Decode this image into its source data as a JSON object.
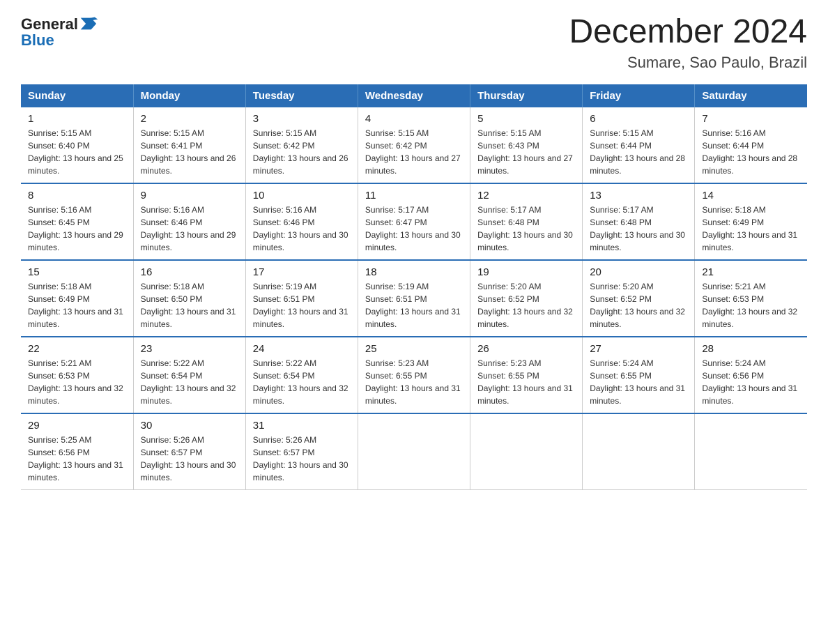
{
  "logo": {
    "text_general": "General",
    "text_blue": "Blue",
    "arrow_color": "#1a6db5"
  },
  "title": "December 2024",
  "subtitle": "Sumare, Sao Paulo, Brazil",
  "headers": [
    "Sunday",
    "Monday",
    "Tuesday",
    "Wednesday",
    "Thursday",
    "Friday",
    "Saturday"
  ],
  "weeks": [
    [
      {
        "day": "1",
        "sunrise": "5:15 AM",
        "sunset": "6:40 PM",
        "daylight": "13 hours and 25 minutes."
      },
      {
        "day": "2",
        "sunrise": "5:15 AM",
        "sunset": "6:41 PM",
        "daylight": "13 hours and 26 minutes."
      },
      {
        "day": "3",
        "sunrise": "5:15 AM",
        "sunset": "6:42 PM",
        "daylight": "13 hours and 26 minutes."
      },
      {
        "day": "4",
        "sunrise": "5:15 AM",
        "sunset": "6:42 PM",
        "daylight": "13 hours and 27 minutes."
      },
      {
        "day": "5",
        "sunrise": "5:15 AM",
        "sunset": "6:43 PM",
        "daylight": "13 hours and 27 minutes."
      },
      {
        "day": "6",
        "sunrise": "5:15 AM",
        "sunset": "6:44 PM",
        "daylight": "13 hours and 28 minutes."
      },
      {
        "day": "7",
        "sunrise": "5:16 AM",
        "sunset": "6:44 PM",
        "daylight": "13 hours and 28 minutes."
      }
    ],
    [
      {
        "day": "8",
        "sunrise": "5:16 AM",
        "sunset": "6:45 PM",
        "daylight": "13 hours and 29 minutes."
      },
      {
        "day": "9",
        "sunrise": "5:16 AM",
        "sunset": "6:46 PM",
        "daylight": "13 hours and 29 minutes."
      },
      {
        "day": "10",
        "sunrise": "5:16 AM",
        "sunset": "6:46 PM",
        "daylight": "13 hours and 30 minutes."
      },
      {
        "day": "11",
        "sunrise": "5:17 AM",
        "sunset": "6:47 PM",
        "daylight": "13 hours and 30 minutes."
      },
      {
        "day": "12",
        "sunrise": "5:17 AM",
        "sunset": "6:48 PM",
        "daylight": "13 hours and 30 minutes."
      },
      {
        "day": "13",
        "sunrise": "5:17 AM",
        "sunset": "6:48 PM",
        "daylight": "13 hours and 30 minutes."
      },
      {
        "day": "14",
        "sunrise": "5:18 AM",
        "sunset": "6:49 PM",
        "daylight": "13 hours and 31 minutes."
      }
    ],
    [
      {
        "day": "15",
        "sunrise": "5:18 AM",
        "sunset": "6:49 PM",
        "daylight": "13 hours and 31 minutes."
      },
      {
        "day": "16",
        "sunrise": "5:18 AM",
        "sunset": "6:50 PM",
        "daylight": "13 hours and 31 minutes."
      },
      {
        "day": "17",
        "sunrise": "5:19 AM",
        "sunset": "6:51 PM",
        "daylight": "13 hours and 31 minutes."
      },
      {
        "day": "18",
        "sunrise": "5:19 AM",
        "sunset": "6:51 PM",
        "daylight": "13 hours and 31 minutes."
      },
      {
        "day": "19",
        "sunrise": "5:20 AM",
        "sunset": "6:52 PM",
        "daylight": "13 hours and 32 minutes."
      },
      {
        "day": "20",
        "sunrise": "5:20 AM",
        "sunset": "6:52 PM",
        "daylight": "13 hours and 32 minutes."
      },
      {
        "day": "21",
        "sunrise": "5:21 AM",
        "sunset": "6:53 PM",
        "daylight": "13 hours and 32 minutes."
      }
    ],
    [
      {
        "day": "22",
        "sunrise": "5:21 AM",
        "sunset": "6:53 PM",
        "daylight": "13 hours and 32 minutes."
      },
      {
        "day": "23",
        "sunrise": "5:22 AM",
        "sunset": "6:54 PM",
        "daylight": "13 hours and 32 minutes."
      },
      {
        "day": "24",
        "sunrise": "5:22 AM",
        "sunset": "6:54 PM",
        "daylight": "13 hours and 32 minutes."
      },
      {
        "day": "25",
        "sunrise": "5:23 AM",
        "sunset": "6:55 PM",
        "daylight": "13 hours and 31 minutes."
      },
      {
        "day": "26",
        "sunrise": "5:23 AM",
        "sunset": "6:55 PM",
        "daylight": "13 hours and 31 minutes."
      },
      {
        "day": "27",
        "sunrise": "5:24 AM",
        "sunset": "6:55 PM",
        "daylight": "13 hours and 31 minutes."
      },
      {
        "day": "28",
        "sunrise": "5:24 AM",
        "sunset": "6:56 PM",
        "daylight": "13 hours and 31 minutes."
      }
    ],
    [
      {
        "day": "29",
        "sunrise": "5:25 AM",
        "sunset": "6:56 PM",
        "daylight": "13 hours and 31 minutes."
      },
      {
        "day": "30",
        "sunrise": "5:26 AM",
        "sunset": "6:57 PM",
        "daylight": "13 hours and 30 minutes."
      },
      {
        "day": "31",
        "sunrise": "5:26 AM",
        "sunset": "6:57 PM",
        "daylight": "13 hours and 30 minutes."
      },
      null,
      null,
      null,
      null
    ]
  ]
}
